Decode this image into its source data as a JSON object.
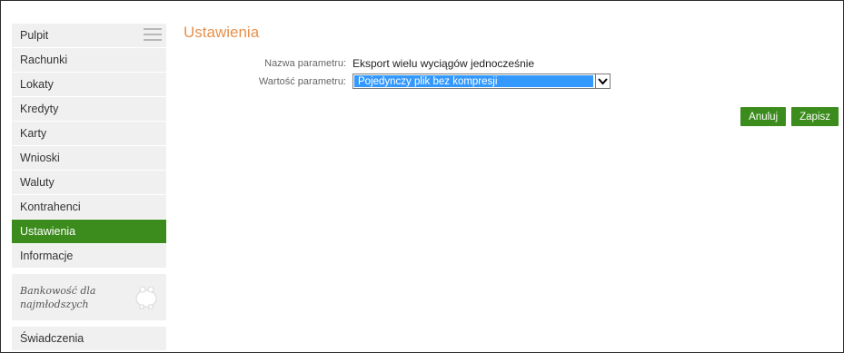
{
  "sidebar": {
    "items": [
      {
        "label": "Pulpit"
      },
      {
        "label": "Rachunki"
      },
      {
        "label": "Lokaty"
      },
      {
        "label": "Kredyty"
      },
      {
        "label": "Karty"
      },
      {
        "label": "Wnioski"
      },
      {
        "label": "Waluty"
      },
      {
        "label": "Kontrahenci"
      },
      {
        "label": "Ustawienia",
        "active": true
      },
      {
        "label": "Informacje"
      }
    ],
    "kids_banner": {
      "line1": "Bankowość dla",
      "line2": "najmłodszych"
    },
    "bottom_item": {
      "label": "Świadczenia"
    }
  },
  "main": {
    "title": "Ustawienia",
    "param_name_label": "Nazwa parametru:",
    "param_name_value": "Eksport wielu wyciągów jednocześnie",
    "param_value_label": "Wartość parametru:",
    "param_value_selected": "Pojedynczy plik bez kompresji"
  },
  "actions": {
    "cancel_label": "Anuluj",
    "save_label": "Zapisz"
  },
  "colors": {
    "accent_green": "#3b8b1d",
    "title_orange": "#e8914b",
    "select_highlight": "#3399ff",
    "sidebar_bg": "#f0f0f0"
  }
}
